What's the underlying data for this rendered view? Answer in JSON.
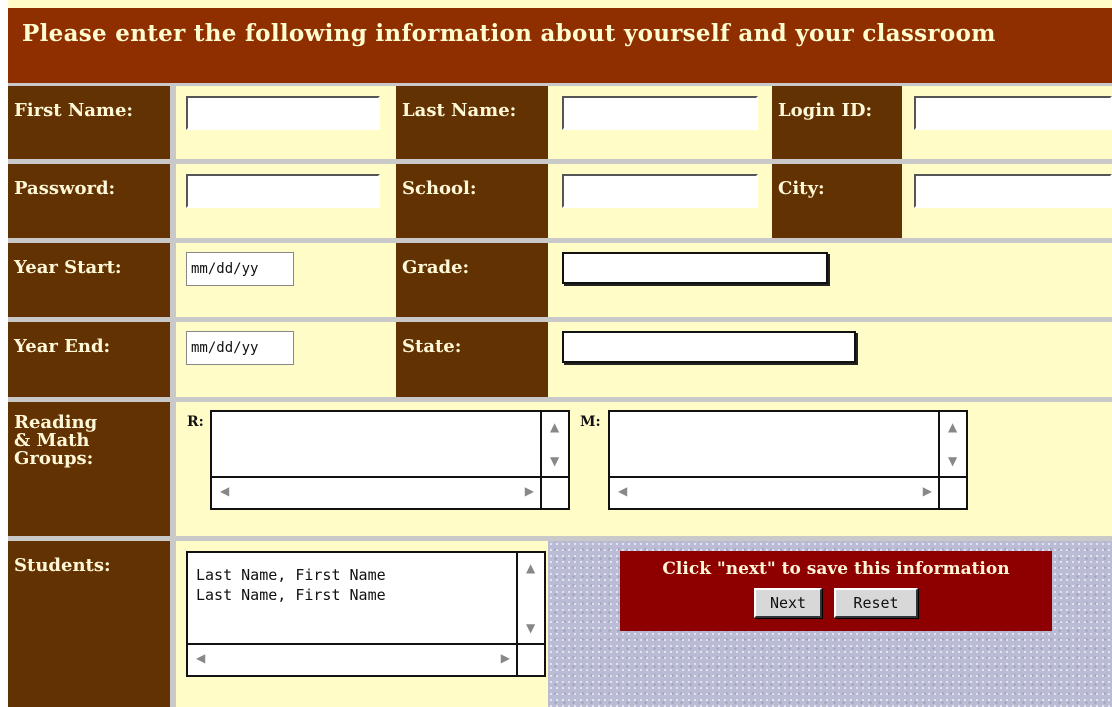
{
  "header": {
    "title": "Please enter the following information about yourself and your classroom"
  },
  "labels": {
    "first_name": "First Name:",
    "last_name": "Last Name:",
    "login_id": "Login ID:",
    "password": "Password:",
    "school": "School:",
    "city": "City:",
    "year_start": "Year Start:",
    "grade": "Grade:",
    "year_end": "Year End:",
    "state": "State:",
    "groups_line1": "Reading",
    "groups_line2": "& Math",
    "groups_line3": "Groups:",
    "students": "Students:"
  },
  "fields": {
    "first_name": "",
    "last_name": "",
    "login_id": "",
    "password": "",
    "school": "",
    "city": "",
    "year_start": "mm/dd/yy",
    "grade": "",
    "year_end": "mm/dd/yy",
    "state": ""
  },
  "groups": {
    "reading_label": "R:",
    "math_label": "M:"
  },
  "students": {
    "lines": "Last Name, First Name\nLast Name, First Name"
  },
  "save": {
    "message": "Click \"next\" to save this information",
    "next_label": "Next",
    "reset_label": "Reset"
  },
  "colors": {
    "header_bg": "#8f2f00",
    "label_bg": "#633202",
    "form_bg": "#fffcc8",
    "save_box_bg": "#8e0000"
  }
}
